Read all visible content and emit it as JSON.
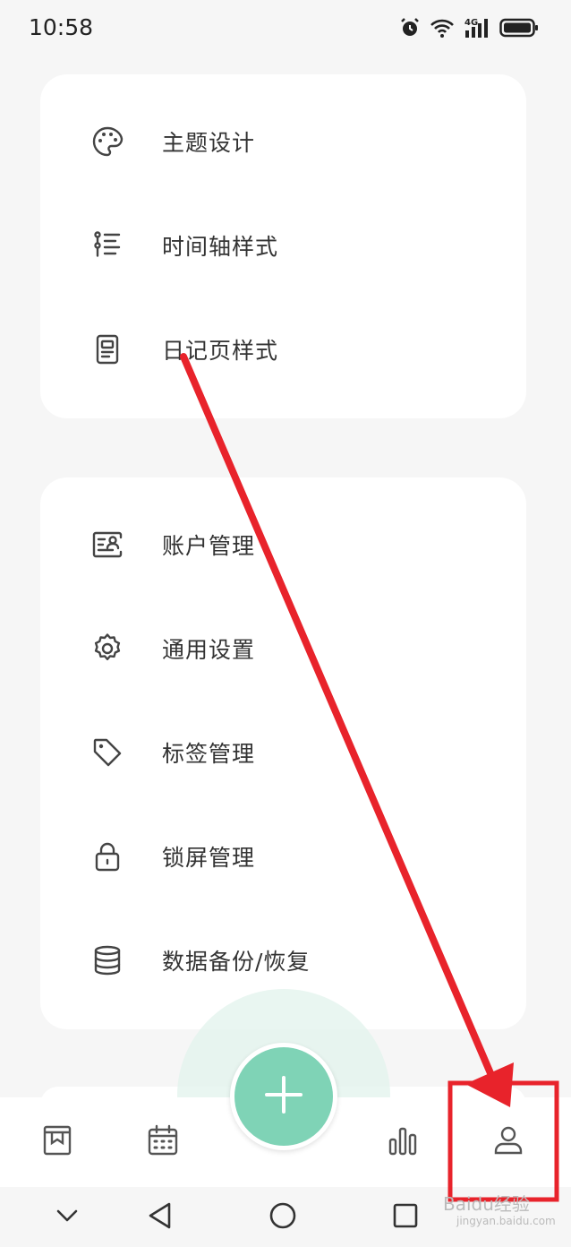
{
  "status_bar": {
    "time": "10:58",
    "icons": [
      "alarm-icon",
      "wifi-icon",
      "4g-signal-icon",
      "battery-icon"
    ],
    "network_label": "4G"
  },
  "settings": {
    "group1": [
      {
        "label": "主题设计",
        "icon": "palette-icon"
      },
      {
        "label": "时间轴样式",
        "icon": "timeline-list-icon"
      },
      {
        "label": "日记页样式",
        "icon": "document-page-icon"
      }
    ],
    "group2": [
      {
        "label": "账户管理",
        "icon": "account-card-icon"
      },
      {
        "label": "通用设置",
        "icon": "gear-icon"
      },
      {
        "label": "标签管理",
        "icon": "tag-icon"
      },
      {
        "label": "锁屏管理",
        "icon": "lock-icon"
      },
      {
        "label": "数据备份/恢复",
        "icon": "database-icon"
      }
    ]
  },
  "bottom_nav": {
    "items": [
      "diary-book-icon",
      "calendar-icon",
      "add-icon",
      "stats-bar-icon",
      "profile-icon"
    ],
    "selected": "profile-icon"
  },
  "annotation": {
    "arrow_color": "#e8232b",
    "highlight": "profile-tab"
  },
  "watermark": {
    "text": "Baidu经验",
    "sub": "jingyan.baidu.com"
  },
  "colors": {
    "accent": "#7fd3b6",
    "background": "#f6f6f6",
    "card": "#ffffff",
    "annotation": "#e8232b"
  }
}
